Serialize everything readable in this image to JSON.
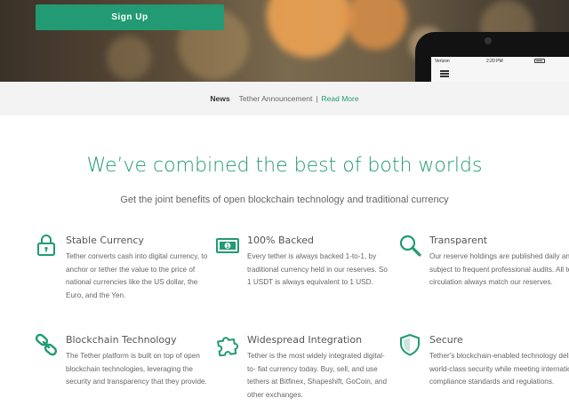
{
  "hero": {
    "signup_label": "Sign Up",
    "phone": {
      "carrier": "Verizon",
      "time": "2:20 PM"
    }
  },
  "news": {
    "label": "News",
    "text": "Tether Announcement",
    "separator": "|",
    "link": "Read More"
  },
  "headline": "We’ve combined the best of both worlds",
  "subheadline": "Get the joint benefits of open blockchain technology and traditional currency",
  "features": [
    {
      "icon": "padlock-icon",
      "title": "Stable Currency",
      "description": "Tether converts cash into digital currency, to anchor or tether the value to the price of national currencies like the US dollar, the Euro, and the Yen."
    },
    {
      "icon": "banknote-icon",
      "title": "100% Backed",
      "description": "Every tether is always backed 1-to-1, by traditional currency held in our reserves. So 1 USDT is always equivalent to 1 USD."
    },
    {
      "icon": "magnifier-icon",
      "title": "Transparent",
      "description": "Our reserve holdings are published daily and subject to frequent professional audits. All tethers in circulation always match our reserves."
    },
    {
      "icon": "chain-link-icon",
      "title": "Blockchain Technology",
      "description": "The Tether platform is built on top of open blockchain technologies, leveraging the security and transparency that they provide."
    },
    {
      "icon": "puzzle-icon",
      "title": "Widespread Integration",
      "description": "Tether is the most widely integrated digital-to- fiat currency today. Buy, sell, and use tethers at Bitfinex, Shapeshift, GoCoin, and other exchanges."
    },
    {
      "icon": "shield-icon",
      "title": "Secure",
      "description": "Tether's blockchain-enabled technology delivers world-class security while meeting international compliance standards and regulations."
    }
  ],
  "colors": {
    "accent": "#229a74",
    "news_bar_bg": "#f3f3f3",
    "text": "#555555"
  }
}
